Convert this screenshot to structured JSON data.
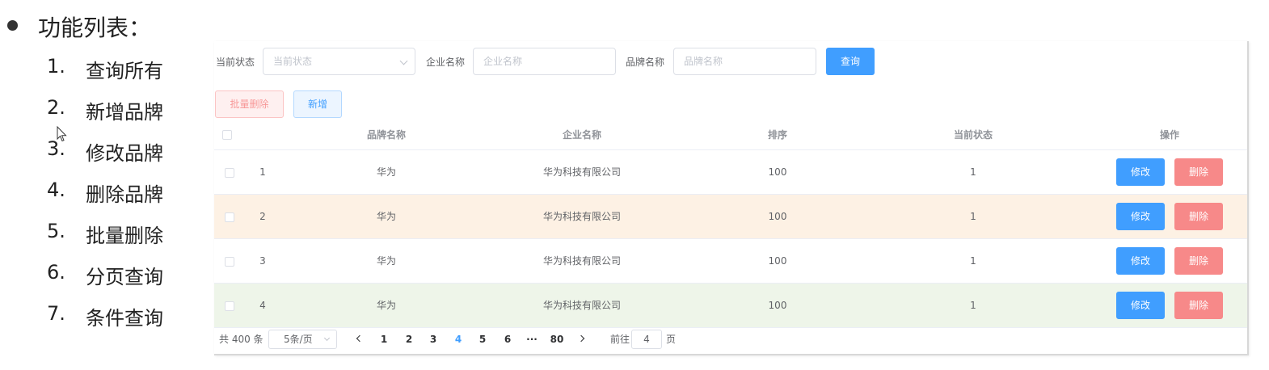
{
  "slide": {
    "heading": "功能列表：",
    "items": [
      {
        "num": "1.",
        "text": "查询所有"
      },
      {
        "num": "2.",
        "text": "新增品牌"
      },
      {
        "num": "3.",
        "text": "修改品牌"
      },
      {
        "num": "4.",
        "text": "删除品牌"
      },
      {
        "num": "5.",
        "text": "批量删除"
      },
      {
        "num": "6.",
        "text": "分页查询"
      },
      {
        "num": "7.",
        "text": "条件查询"
      }
    ]
  },
  "search": {
    "status_label": "当前状态",
    "status_placeholder": "当前状态",
    "company_label": "企业名称",
    "company_placeholder": "企业名称",
    "brand_label": "品牌名称",
    "brand_placeholder": "品牌名称",
    "query_button": "查询"
  },
  "toolbar": {
    "batch_delete": "批量删除",
    "add": "新增"
  },
  "table": {
    "headers": {
      "brand": "品牌名称",
      "company": "企业名称",
      "order": "排序",
      "status": "当前状态",
      "actions": "操作"
    },
    "edit_label": "修改",
    "delete_label": "删除",
    "rows": [
      {
        "index": "1",
        "brand": "华为",
        "company": "华为科技有限公司",
        "order": "100",
        "status": "1",
        "highlight": "#ffffff"
      },
      {
        "index": "2",
        "brand": "华为",
        "company": "华为科技有限公司",
        "order": "100",
        "status": "1",
        "highlight": "#fdf1e4"
      },
      {
        "index": "3",
        "brand": "华为",
        "company": "华为科技有限公司",
        "order": "100",
        "status": "1",
        "highlight": "#ffffff"
      },
      {
        "index": "4",
        "brand": "华为",
        "company": "华为科技有限公司",
        "order": "100",
        "status": "1",
        "highlight": "#eef5e9"
      }
    ]
  },
  "pagination": {
    "total": "共 400 条",
    "page_size": "5条/页",
    "pages": [
      "1",
      "2",
      "3",
      "4",
      "5",
      "6"
    ],
    "ellipsis": "···",
    "last_page": "80",
    "current_page": "4",
    "goto_prefix": "前往",
    "goto_value": "4",
    "goto_suffix": "页"
  },
  "colors": {
    "primary": "#409eff",
    "danger": "#f78989"
  }
}
